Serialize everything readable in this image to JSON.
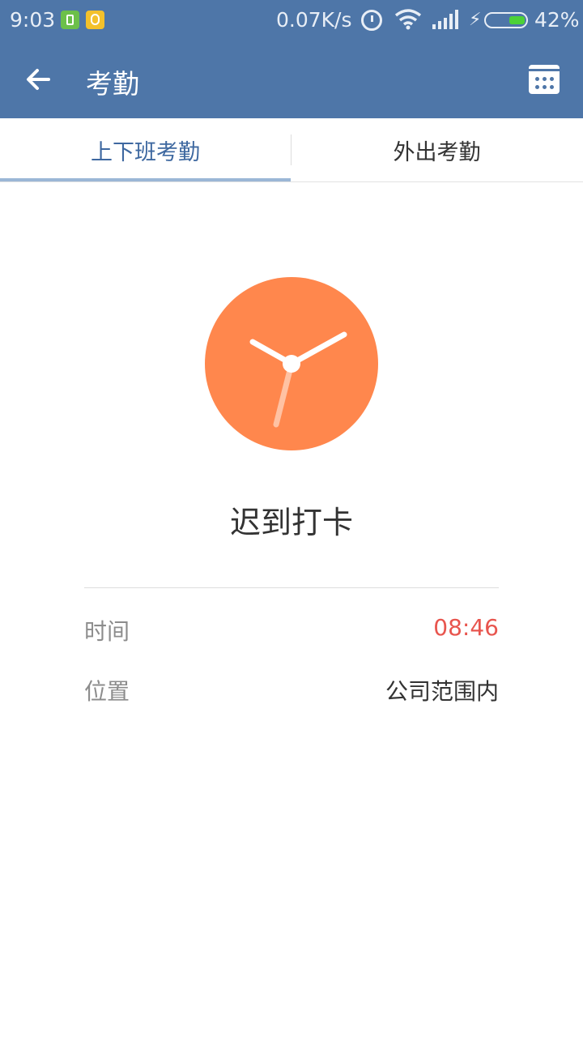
{
  "status_bar": {
    "time": "9:03",
    "net_speed": "0.07K/s",
    "battery_percent": "42%",
    "battery_level": 0.42,
    "icons": [
      "battery-app-icon",
      "notification-app-icon",
      "alarm-icon",
      "wifi-icon",
      "signal-icon",
      "charging-icon",
      "battery-icon"
    ]
  },
  "app_bar": {
    "title": "考勤",
    "back_icon": "arrow-left-icon",
    "calendar_icon": "calendar-icon"
  },
  "tabs": [
    {
      "label": "上下班考勤",
      "active": true
    },
    {
      "label": "外出考勤",
      "active": false
    }
  ],
  "punch": {
    "icon": "clock-icon",
    "status": "迟到打卡",
    "time_label": "时间",
    "time_value": "08:46",
    "location_label": "位置",
    "location_value": "公司范围内"
  },
  "colors": {
    "primary": "#4e76a8",
    "clock": "#ff874d",
    "late": "#e8554e",
    "tab_active": "#3e68a0"
  }
}
